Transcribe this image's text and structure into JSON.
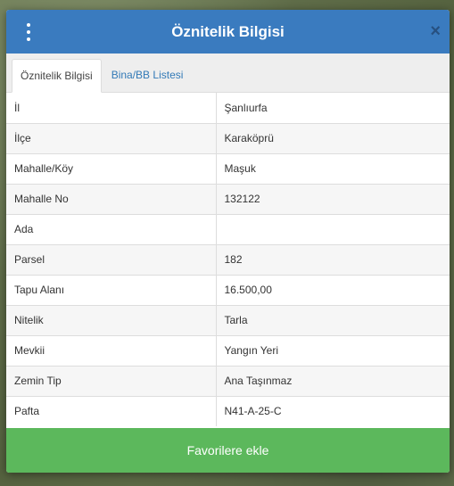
{
  "header": {
    "title": "Öznitelik Bilgisi",
    "close_symbol": "×",
    "color": "#3a7bbf"
  },
  "tabs": [
    {
      "label": "Öznitelik Bilgisi",
      "active": true
    },
    {
      "label": "Bina/BB Listesi",
      "active": false
    }
  ],
  "rows": [
    {
      "key": "İl",
      "value": "Şanlıurfa"
    },
    {
      "key": "İlçe",
      "value": "Karaköprü"
    },
    {
      "key": "Mahalle/Köy",
      "value": "Maşuk"
    },
    {
      "key": "Mahalle No",
      "value": "132122"
    },
    {
      "key": "Ada",
      "value": ""
    },
    {
      "key": "Parsel",
      "value": "182"
    },
    {
      "key": "Tapu Alanı",
      "value": "16.500,00"
    },
    {
      "key": "Nitelik",
      "value": "Tarla"
    },
    {
      "key": "Mevkii",
      "value": "Yangın Yeri"
    },
    {
      "key": "Zemin Tip",
      "value": "Ana Taşınmaz"
    },
    {
      "key": "Pafta",
      "value": "N41-A-25-C"
    }
  ],
  "footer": {
    "favorite_label": "Favorilere ekle",
    "color": "#5cb85c"
  },
  "icons": [
    "menu-dots-icon",
    "close-icon"
  ]
}
